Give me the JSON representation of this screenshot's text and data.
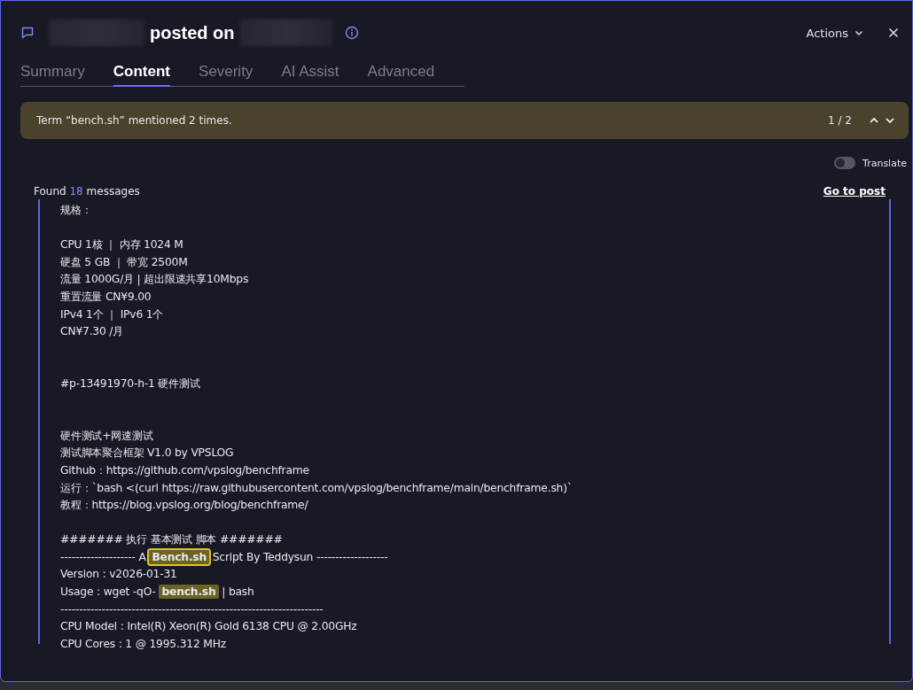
{
  "header": {
    "title": "posted on",
    "actions": "Actions"
  },
  "tabs": [
    {
      "label": "Summary",
      "selected": false
    },
    {
      "label": "Content",
      "selected": true
    },
    {
      "label": "Severity",
      "selected": false
    },
    {
      "label": "AI Assist",
      "selected": false
    },
    {
      "label": "Advanced",
      "selected": false
    }
  ],
  "banner": {
    "text": "Term “bench.sh” mentioned 2 times.",
    "position": "1 / 2"
  },
  "translate": {
    "label": "Translate",
    "on": false
  },
  "results": {
    "prefix": "Found",
    "count": "18",
    "suffix": "messages"
  },
  "go_to_post": "Go to post",
  "lines": [
    {
      "kind": "text",
      "segments": [
        {
          "text": "规格："
        }
      ]
    },
    {
      "kind": "blank"
    },
    {
      "kind": "text",
      "segments": [
        {
          "text": "CPU 1核 ｜ 内存 1024 M"
        }
      ]
    },
    {
      "kind": "text",
      "segments": [
        {
          "text": "硬盘 5 GB ｜ 带宽 2500M"
        }
      ]
    },
    {
      "kind": "text",
      "segments": [
        {
          "text": "流量 1000G/月 | 超出限速共享10Mbps"
        }
      ]
    },
    {
      "kind": "text",
      "segments": [
        {
          "text": "重置流量 CN¥9.00"
        }
      ]
    },
    {
      "kind": "text",
      "segments": [
        {
          "text": "IPv4 1个 ｜ IPv6 1个"
        }
      ]
    },
    {
      "kind": "text",
      "segments": [
        {
          "text": "CN¥7.30 /月"
        }
      ]
    },
    {
      "kind": "blank"
    },
    {
      "kind": "blank"
    },
    {
      "kind": "text",
      "segments": [
        {
          "text": "#p-13491970-h-1 硬件测试"
        }
      ]
    },
    {
      "kind": "blank"
    },
    {
      "kind": "blank"
    },
    {
      "kind": "text",
      "segments": [
        {
          "text": "硬件测试+网速测试"
        }
      ]
    },
    {
      "kind": "text",
      "segments": [
        {
          "text": "测试脚本聚合框架 V1.0 by VPSLOG"
        }
      ]
    },
    {
      "kind": "text",
      "segments": [
        {
          "text": "Github：https://github.com/vpslog/benchframe"
        }
      ]
    },
    {
      "kind": "text",
      "segments": [
        {
          "text": "运行：`bash <(curl https://raw.githubusercontent.com/vpslog/benchframe/main/benchframe.sh)`"
        }
      ]
    },
    {
      "kind": "text",
      "segments": [
        {
          "text": "教程：https://blog.vpslog.org/blog/benchframe/"
        }
      ]
    },
    {
      "kind": "blank"
    },
    {
      "kind": "text",
      "segments": [
        {
          "text": "####### 执行 基本测试 脚本 #######"
        }
      ]
    },
    {
      "kind": "text",
      "segments": [
        {
          "text": "-------------------- A "
        },
        {
          "text": "Bench.sh",
          "highlighted": true,
          "current": true
        },
        {
          "text": " Script By Teddysun -------------------"
        }
      ]
    },
    {
      "kind": "text",
      "segments": [
        {
          "text": "Version : v2026-01-31"
        }
      ]
    },
    {
      "kind": "text",
      "segments": [
        {
          "text": "Usage : wget -qO- "
        },
        {
          "text": "bench.sh",
          "highlighted": true,
          "current": false
        },
        {
          "text": " | bash"
        }
      ]
    },
    {
      "kind": "text",
      "segments": [
        {
          "text": "----------------------------------------------------------------------"
        }
      ]
    },
    {
      "kind": "text",
      "segments": [
        {
          "text": "CPU Model : Intel(R) Xeon(R) Gold 6138 CPU @ 2.00GHz"
        }
      ]
    },
    {
      "kind": "text",
      "segments": [
        {
          "text": "CPU Cores : 1 @ 1995.312 MHz"
        }
      ]
    }
  ]
}
